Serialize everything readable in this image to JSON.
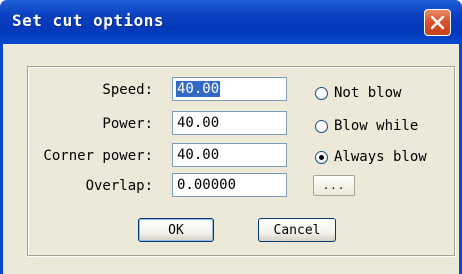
{
  "window": {
    "title": "Set cut options"
  },
  "fields": [
    {
      "label": "Speed:",
      "value": "40.00",
      "selected": true
    },
    {
      "label": "Power:",
      "value": "40.00",
      "selected": false
    },
    {
      "label": "Corner power:",
      "value": "40.00",
      "selected": false
    },
    {
      "label": "Overlap:",
      "value": "0.00000",
      "selected": false
    }
  ],
  "blow_options": [
    {
      "label": "Not blow",
      "checked": false
    },
    {
      "label": "Blow while",
      "checked": false
    },
    {
      "label": "Always blow",
      "checked": true
    }
  ],
  "buttons": {
    "ok": "OK",
    "cancel": "Cancel",
    "browse": "..."
  },
  "colors": {
    "titlebar": "#0a3fc1",
    "client": "#ece9d8",
    "close": "#d9542e",
    "selection": "#316ac5"
  },
  "icons": {
    "close": "close-icon"
  }
}
